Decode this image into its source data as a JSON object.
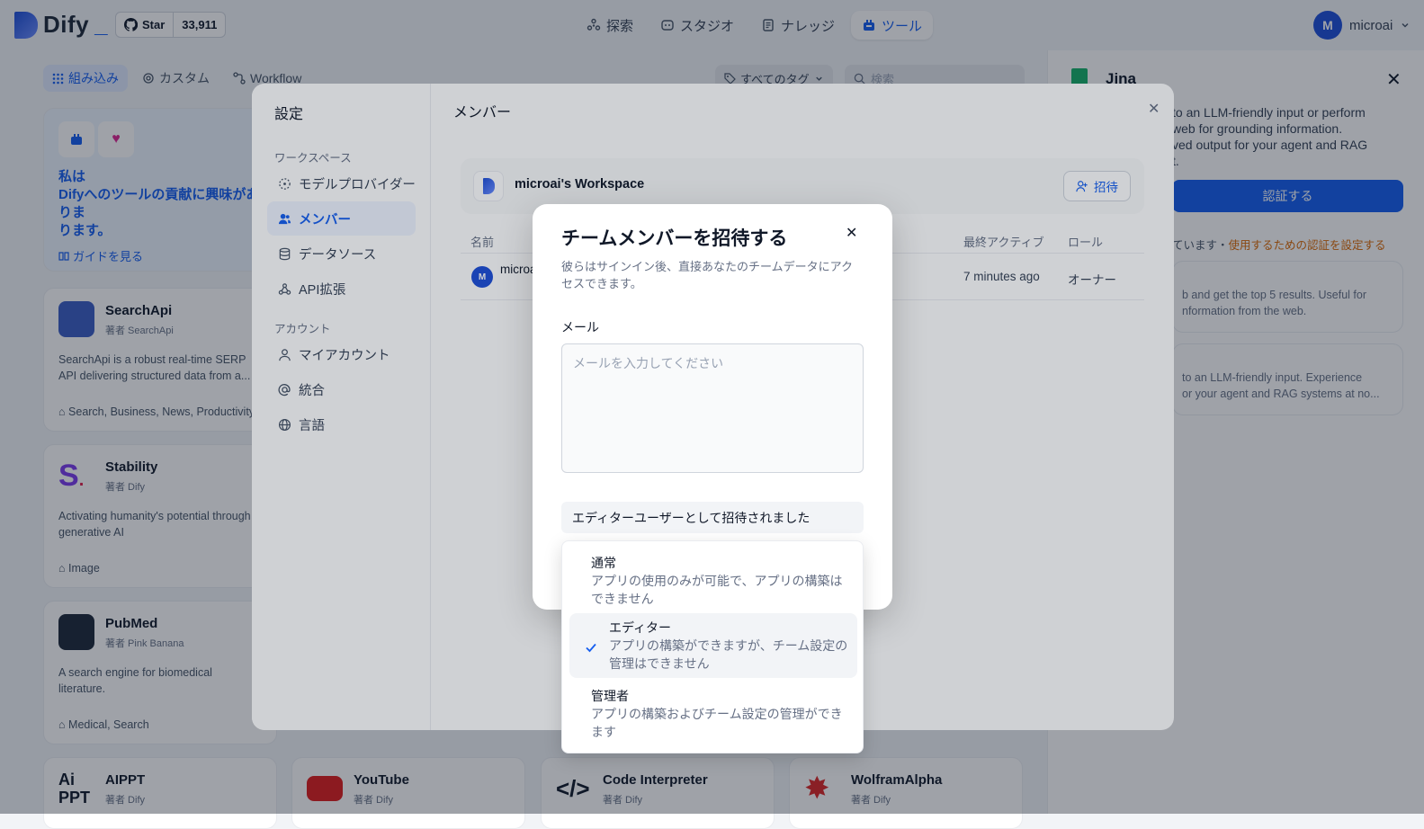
{
  "topbar": {
    "logo_text": "Dify",
    "github_star_label": "Star",
    "github_star_count": "33,911",
    "nav": [
      {
        "label": "探索",
        "icon": "explore-icon"
      },
      {
        "label": "スタジオ",
        "icon": "studio-icon"
      },
      {
        "label": "ナレッジ",
        "icon": "knowledge-icon"
      },
      {
        "label": "ツール",
        "icon": "tools-icon",
        "active": true
      }
    ],
    "user": {
      "initial": "M",
      "name": "microai"
    }
  },
  "tools_page": {
    "tabs": [
      {
        "label": "組み込み",
        "active": true
      },
      {
        "label": "カスタム"
      },
      {
        "label": "Workflow"
      }
    ],
    "tag_filter": "すべてのタグ",
    "search_placeholder": "検索",
    "contribute_card": {
      "text": "私は\nDifyへのツールの貢献に興味がありま",
      "text2": "ります。",
      "guide_link": "ガイドを見る"
    },
    "cards": [
      {
        "name": "SearchApi",
        "author": "著者 SearchApi",
        "desc1": "SearchApi is a robust real-time SERP",
        "desc2": "API delivering structured data from a...",
        "tags": "Search, Business, News, Productivity"
      },
      {
        "name": "Stability",
        "author": "著者 Dify",
        "desc1": "Activating humanity's potential through",
        "desc2": "generative AI",
        "tags": "Image"
      },
      {
        "name": "PubMed",
        "author": "著者 Pink Banana",
        "desc1": "A search engine for biomedical",
        "desc2": "literature.",
        "tags": "Medical, Search"
      },
      {
        "name": "AIPPT",
        "author": "著者 Dify"
      },
      {
        "name": "YouTube",
        "author": "著者 Dify"
      },
      {
        "name": "Code Interpreter",
        "author": "著者 Dify"
      },
      {
        "name": "WolframAlpha",
        "author": "著者 Dify"
      }
    ]
  },
  "right_panel": {
    "title": "Jina",
    "desc1": "to an LLM-friendly input or perform",
    "desc2": "web for grounding information.",
    "desc3": "ved output for your agent and RAG",
    "desc4": "t.",
    "auth_button": "認証する",
    "auth_note_prefix": "ています・",
    "auth_note_link": "使用するための認証を設定する",
    "tool1_line1": "b and get the top 5 results. Useful for",
    "tool1_line2": "nformation from the web.",
    "tool2_line1": "to an LLM-friendly input. Experience",
    "tool2_line2": "or your agent and RAG systems at no..."
  },
  "settings": {
    "title": "設定",
    "workspace_group": "ワークスペース",
    "account_group": "アカウント",
    "items": [
      {
        "label": "モデルプロバイダー"
      },
      {
        "label": "メンバー",
        "active": true
      },
      {
        "label": "データソース"
      },
      {
        "label": "API拡張"
      },
      {
        "label": "マイアカウント"
      },
      {
        "label": "統合"
      },
      {
        "label": "言語"
      }
    ],
    "page_title": "メンバー",
    "workspace_name": "microai's Workspace",
    "invite_button": "招待",
    "columns": {
      "name": "名前",
      "last_active": "最終アクティブ",
      "role": "ロール"
    },
    "member": {
      "initial": "M",
      "name": "microa",
      "last_active": "7 minutes ago",
      "role": "オーナー"
    }
  },
  "invite_modal": {
    "title": "チームメンバーを招待する",
    "desc": "彼らはサインイン後、直接あなたのチームデータにアクセスできます。",
    "email_label": "メール",
    "email_placeholder": "メールを入力してください",
    "role_select": "エディターユーザーとして招待されました",
    "options": [
      {
        "title": "通常",
        "desc": "アプリの使用のみが可能で、アプリの構築はできません"
      },
      {
        "title": "エディター",
        "desc": "アプリの構築ができますが、チーム設定の管理はできません",
        "selected": true
      },
      {
        "title": "管理者",
        "desc": "アプリの構築およびチーム設定の管理ができます"
      }
    ]
  }
}
